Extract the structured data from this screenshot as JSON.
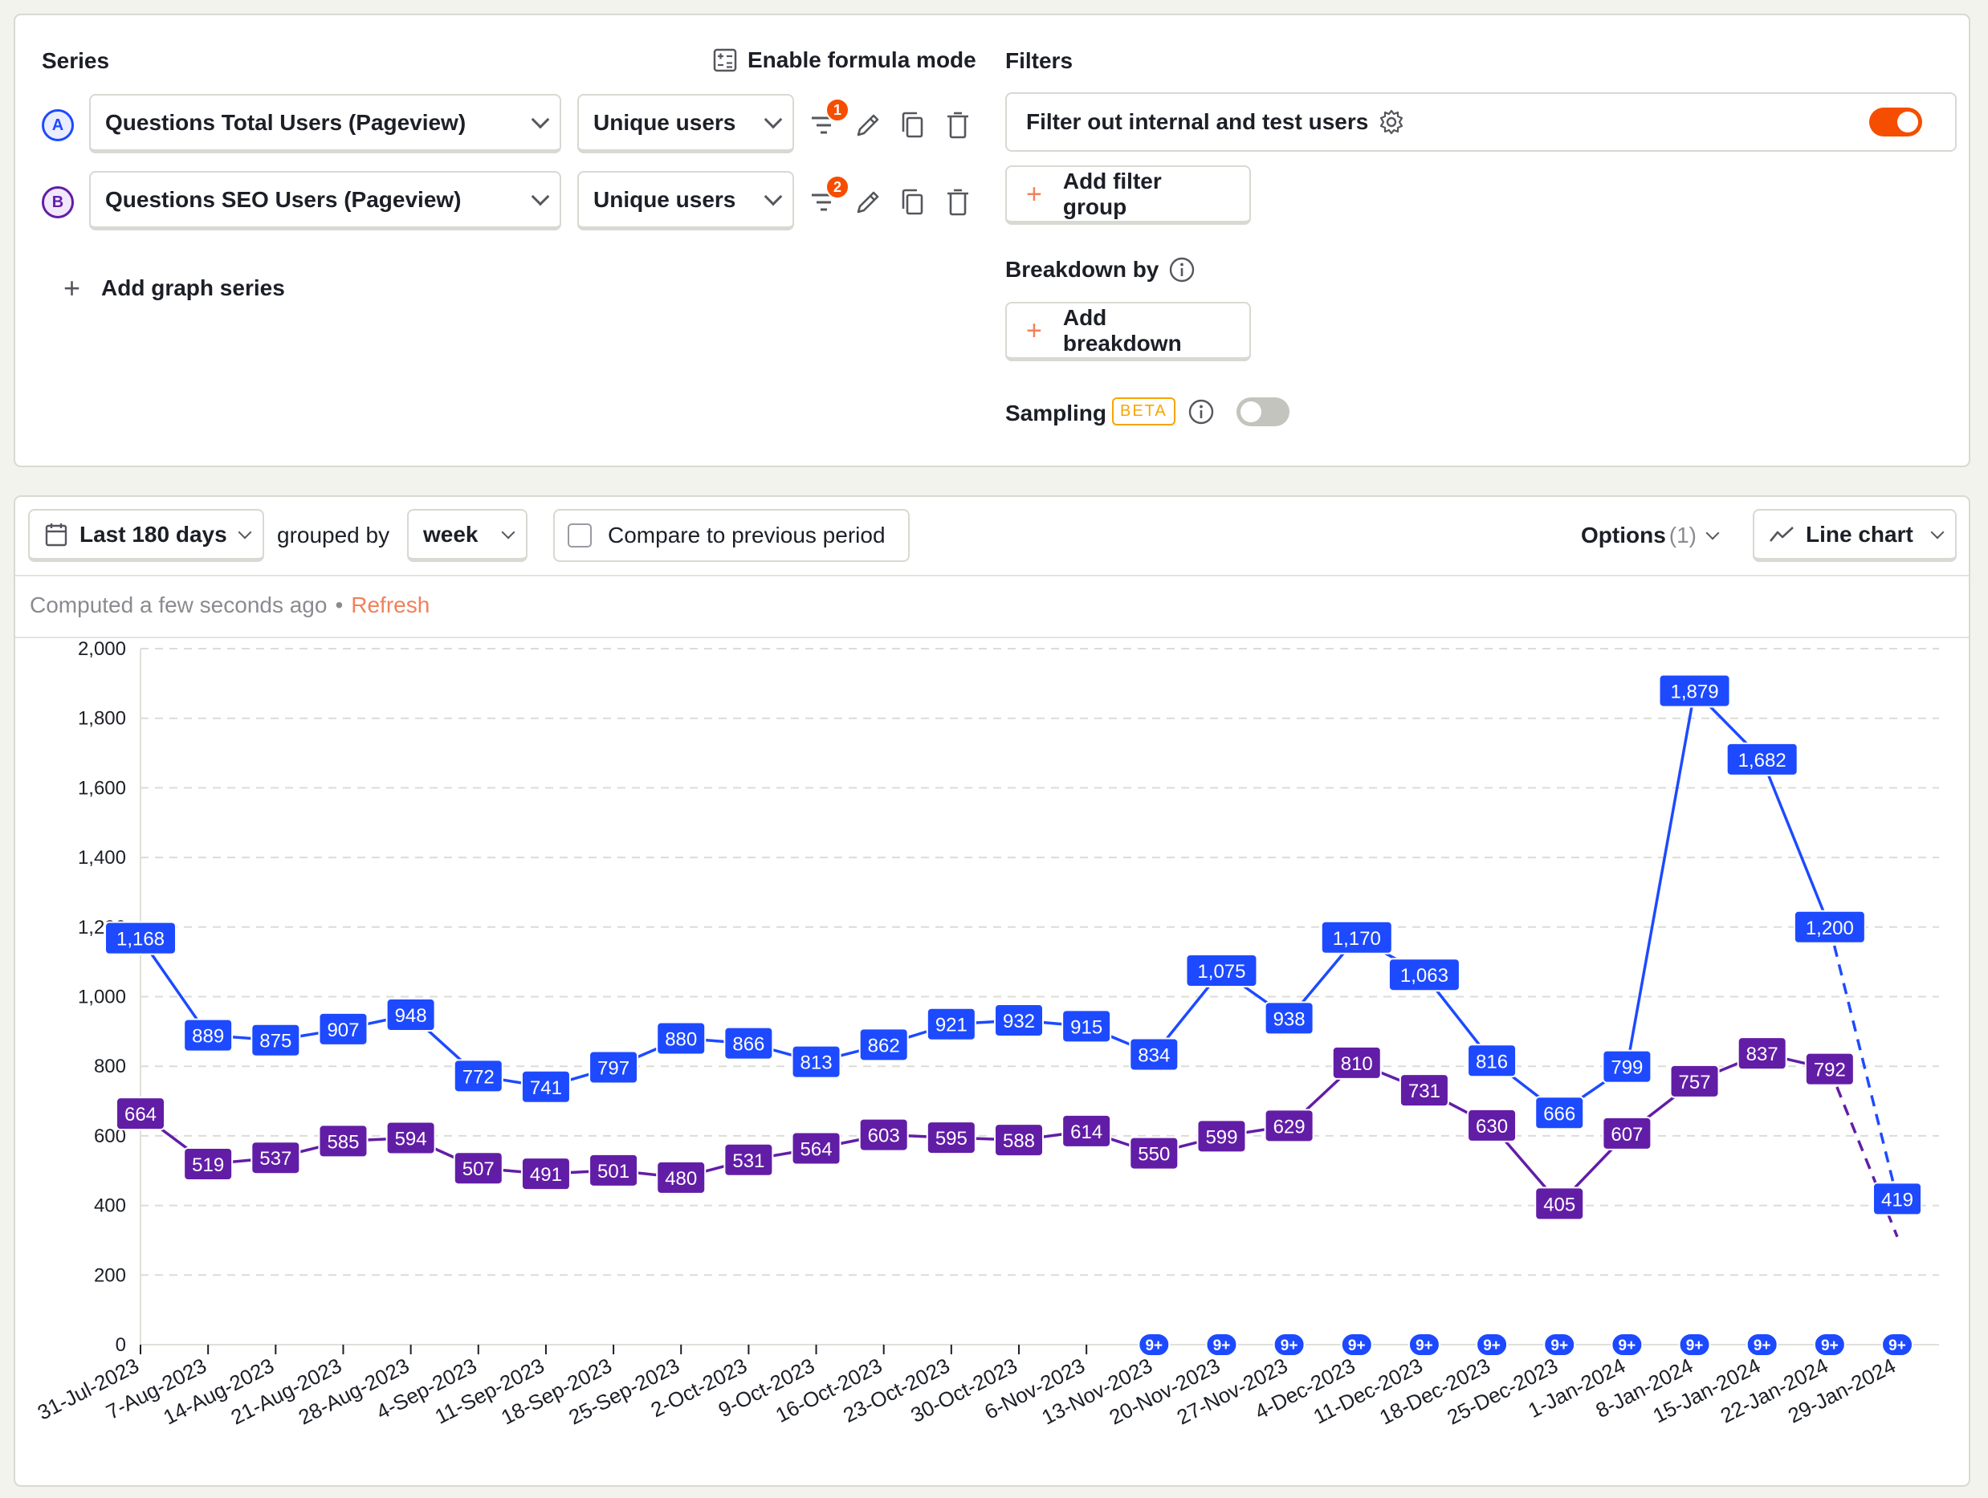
{
  "series_panel": {
    "title": "Series",
    "formula_mode_label": "Enable formula mode",
    "series": [
      {
        "letter": "A",
        "event": "Questions Total Users (Pageview)",
        "math": "Unique users",
        "filter_count": "1"
      },
      {
        "letter": "B",
        "event": "Questions SEO Users (Pageview)",
        "math": "Unique users",
        "filter_count": "2"
      }
    ],
    "add_series_label": "Add graph series"
  },
  "filters_panel": {
    "title": "Filters",
    "internal_filter_label": "Filter out internal and test users",
    "internal_filter_enabled": true,
    "add_filter_group_label": "Add filter group",
    "breakdown_title": "Breakdown by",
    "add_breakdown_label": "Add breakdown",
    "sampling_label": "Sampling",
    "sampling_badge": "BETA",
    "sampling_enabled": false
  },
  "toolbar": {
    "date_range": "Last 180 days",
    "grouped_by_label": "grouped by",
    "interval": "week",
    "compare_label": "Compare to previous period",
    "options_label": "Options",
    "options_count": "(1)",
    "chart_type": "Line chart"
  },
  "status": {
    "computed": "Computed a few seconds ago",
    "dot": "•",
    "refresh": "Refresh"
  },
  "colors": {
    "series_a": "#1d4aff",
    "series_b": "#621da6",
    "accent": "#f54e00",
    "refresh": "#f1805b"
  },
  "annotation_marker": "9+",
  "chart_data": {
    "type": "line",
    "categories": [
      "31-Jul-2023",
      "7-Aug-2023",
      "14-Aug-2023",
      "21-Aug-2023",
      "28-Aug-2023",
      "4-Sep-2023",
      "11-Sep-2023",
      "18-Sep-2023",
      "25-Sep-2023",
      "2-Oct-2023",
      "9-Oct-2023",
      "16-Oct-2023",
      "23-Oct-2023",
      "30-Oct-2023",
      "6-Nov-2023",
      "13-Nov-2023",
      "20-Nov-2023",
      "27-Nov-2023",
      "4-Dec-2023",
      "11-Dec-2023",
      "18-Dec-2023",
      "25-Dec-2023",
      "1-Jan-2024",
      "8-Jan-2024",
      "15-Jan-2024",
      "22-Jan-2024",
      "29-Jan-2024"
    ],
    "series": [
      {
        "values": [
          1168,
          889,
          875,
          907,
          948,
          772,
          741,
          797,
          880,
          866,
          813,
          862,
          921,
          932,
          915,
          834,
          1075,
          938,
          1170,
          1063,
          816,
          666,
          799,
          1879,
          1682,
          1200,
          419
        ],
        "labels": [
          "1,168",
          "889",
          "875",
          "907",
          "948",
          "772",
          "741",
          "797",
          "880",
          "866",
          "813",
          "862",
          "921",
          "932",
          "915",
          "834",
          "1,075",
          "938",
          "1,170",
          "1,063",
          "816",
          "666",
          "799",
          "1,879",
          "1,682",
          "1,200",
          "419"
        ]
      },
      {
        "values": [
          664,
          519,
          537,
          585,
          594,
          507,
          491,
          501,
          480,
          531,
          564,
          603,
          595,
          588,
          614,
          550,
          599,
          629,
          810,
          731,
          630,
          405,
          607,
          757,
          837,
          792,
          310
        ],
        "labels": [
          "664",
          "519",
          "537",
          "585",
          "594",
          "507",
          "491",
          "501",
          "480",
          "531",
          "564",
          "603",
          "595",
          "588",
          "614",
          "550",
          "599",
          "629",
          "810",
          "731",
          "630",
          "405",
          "607",
          "757",
          "837",
          "792",
          ""
        ]
      }
    ],
    "yticks": [
      "0",
      "200",
      "400",
      "600",
      "800",
      "1,000",
      "1,200",
      "1,400",
      "1,600",
      "1,800",
      "2,000"
    ],
    "ylim": [
      0,
      2000
    ],
    "grid": true,
    "incomplete_last_period": true,
    "annotation_start_index": 15
  }
}
